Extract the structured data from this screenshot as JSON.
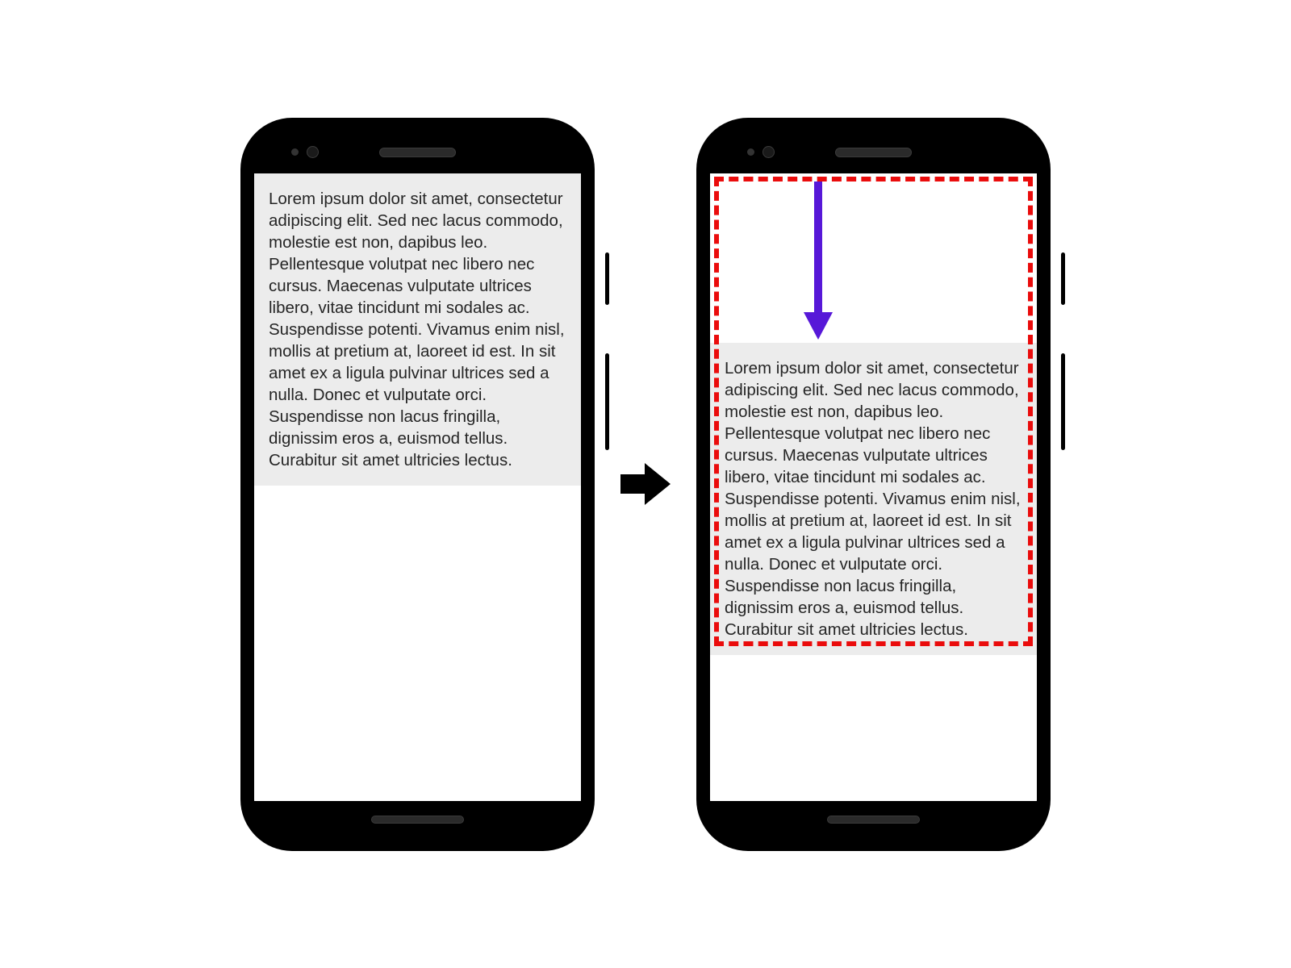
{
  "text_block": "Lorem ipsum dolor sit amet, consectetur adipiscing elit. Sed nec lacus commodo, molestie est non, dapibus leo. Pellentesque volutpat nec libero nec cursus. Maecenas vulputate ultrices libero, vitae tincidunt mi sodales ac. Suspendisse potenti. Vivamus enim nisl, mollis at pretium at, laoreet id est. In sit amet ex a ligula pulvinar ultrices sed a nulla. Donec et vulputate orci. Suspendisse non lacus fringilla, dignissim eros a, euismod tellus. Curabitur sit amet ultricies lectus.",
  "colors": {
    "highlight_border": "#ea0c0c",
    "arrow_down": "#5718d8",
    "transition_arrow": "#000000",
    "text_bg": "#ececec"
  }
}
